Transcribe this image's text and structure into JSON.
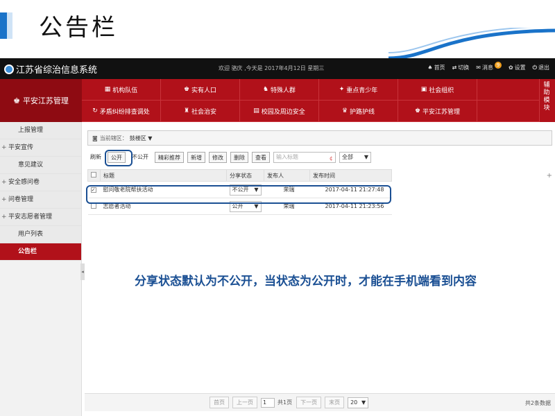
{
  "slide": {
    "title": "公告栏"
  },
  "topbar": {
    "brand": "江苏省综治信息系统",
    "welcome": "欢迎 骆庆 ,今天是 2017年4月12日 星期三",
    "links": [
      {
        "icon": "home-icon",
        "glyph": "♠",
        "label": "首页"
      },
      {
        "icon": "switch-icon",
        "glyph": "⇄",
        "label": "切换"
      },
      {
        "icon": "message-icon",
        "glyph": "✉",
        "label": "消息",
        "badge": "9"
      },
      {
        "icon": "gear-icon",
        "glyph": "✿",
        "label": "设置"
      },
      {
        "icon": "logout-icon",
        "glyph": "⏻",
        "label": "退出"
      }
    ]
  },
  "module": {
    "title": "平安江苏管理",
    "side_label": "辅助模块"
  },
  "nav": {
    "row1": [
      {
        "icon": "org-icon",
        "glyph": "▦",
        "label": "机构队伍"
      },
      {
        "icon": "population-icon",
        "glyph": "♚",
        "label": "实有人口"
      },
      {
        "icon": "people-icon",
        "glyph": "♞",
        "label": "特殊人群"
      },
      {
        "icon": "youth-icon",
        "glyph": "✦",
        "label": "重点青少年"
      },
      {
        "icon": "social-org-icon",
        "glyph": "▣",
        "label": "社会组织"
      }
    ],
    "row2": [
      {
        "icon": "dispute-icon",
        "glyph": "↻",
        "label": "矛盾纠纷排查调处"
      },
      {
        "icon": "security-icon",
        "glyph": "♜",
        "label": "社会治安"
      },
      {
        "icon": "campus-icon",
        "glyph": "▤",
        "label": "校园及周边安全"
      },
      {
        "icon": "road-icon",
        "glyph": "♛",
        "label": "护路护线"
      },
      {
        "icon": "safe-icon",
        "glyph": "♚",
        "label": "平安江苏管理"
      }
    ]
  },
  "sidebar": {
    "items": [
      {
        "label": "上报管理",
        "prefix": ""
      },
      {
        "label": "平安宣传",
        "prefix": "+"
      },
      {
        "label": "意见建议",
        "prefix": ""
      },
      {
        "label": "安全感问卷",
        "prefix": "+"
      },
      {
        "label": "问卷管理",
        "prefix": "+"
      },
      {
        "label": "平安志愿者管理",
        "prefix": "+"
      },
      {
        "label": "用户列表",
        "prefix": ""
      },
      {
        "label": "公告栏",
        "prefix": ""
      }
    ]
  },
  "crumb": {
    "label": "当前辖区：",
    "value": "鼓楼区"
  },
  "toolbar": {
    "refresh": "刷新",
    "public": "公开",
    "private": "不公开",
    "recommend": "精彩推荐",
    "add": "新增",
    "edit": "修改",
    "delete": "删除",
    "view": "查看",
    "search_placeholder": "输入标题",
    "filter": "全部"
  },
  "table": {
    "headers": [
      "标题",
      "分享状态",
      "发布人",
      "发布时间"
    ],
    "rows": [
      {
        "checked": true,
        "title": "慰问敬老院帮扶活动",
        "status": "不公开",
        "publisher": "荣瑞",
        "time": "2017-04-11 21:27:48"
      },
      {
        "checked": false,
        "title": "志愿者活动",
        "status": "公开",
        "publisher": "荣瑞",
        "time": "2017-04-11 21:23:56"
      }
    ]
  },
  "note": "分享状态默认为不公开，当状态为公开时，才能在手机端看到内容",
  "pager": {
    "first": "首页",
    "prev": "上一页",
    "page": "1",
    "pages": "共1页",
    "next": "下一页",
    "last": "末页",
    "size": "20",
    "total": "共2条数据"
  },
  "colors": {
    "accent": "#b1111a",
    "callout": "#1a4f93"
  }
}
